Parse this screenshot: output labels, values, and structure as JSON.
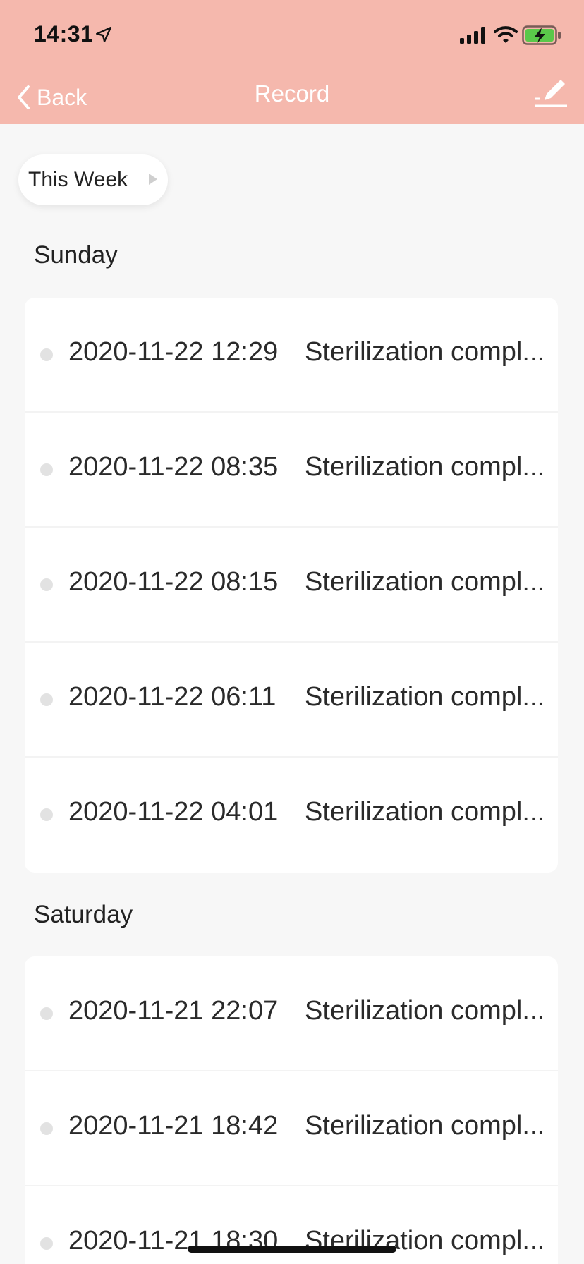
{
  "status_bar": {
    "time": "14:31"
  },
  "nav": {
    "back_label": "Back",
    "title": "Record"
  },
  "filter": {
    "label": "This Week"
  },
  "sections": [
    {
      "title": "Sunday",
      "rows": [
        {
          "time": "2020-11-22 12:29",
          "status": "Sterilization compl..."
        },
        {
          "time": "2020-11-22 08:35",
          "status": "Sterilization compl..."
        },
        {
          "time": "2020-11-22 08:15",
          "status": "Sterilization compl..."
        },
        {
          "time": "2020-11-22 06:11",
          "status": "Sterilization compl..."
        },
        {
          "time": "2020-11-22 04:01",
          "status": "Sterilization compl..."
        }
      ]
    },
    {
      "title": "Saturday",
      "rows": [
        {
          "time": "2020-11-21 22:07",
          "status": "Sterilization compl..."
        },
        {
          "time": "2020-11-21 18:42",
          "status": "Sterilization compl..."
        },
        {
          "time": "2020-11-21 18:30",
          "status": "Sterilization compl..."
        }
      ]
    }
  ],
  "colors": {
    "header_bg": "#f5b8ad",
    "battery_fill": "#5ac84a",
    "page_bg": "#f7f7f7"
  },
  "icons": [
    "location-arrow-icon",
    "signal-icon",
    "wifi-icon",
    "battery-charging-icon",
    "chevron-left-icon",
    "edit-pencil-icon",
    "triangle-right-icon"
  ]
}
